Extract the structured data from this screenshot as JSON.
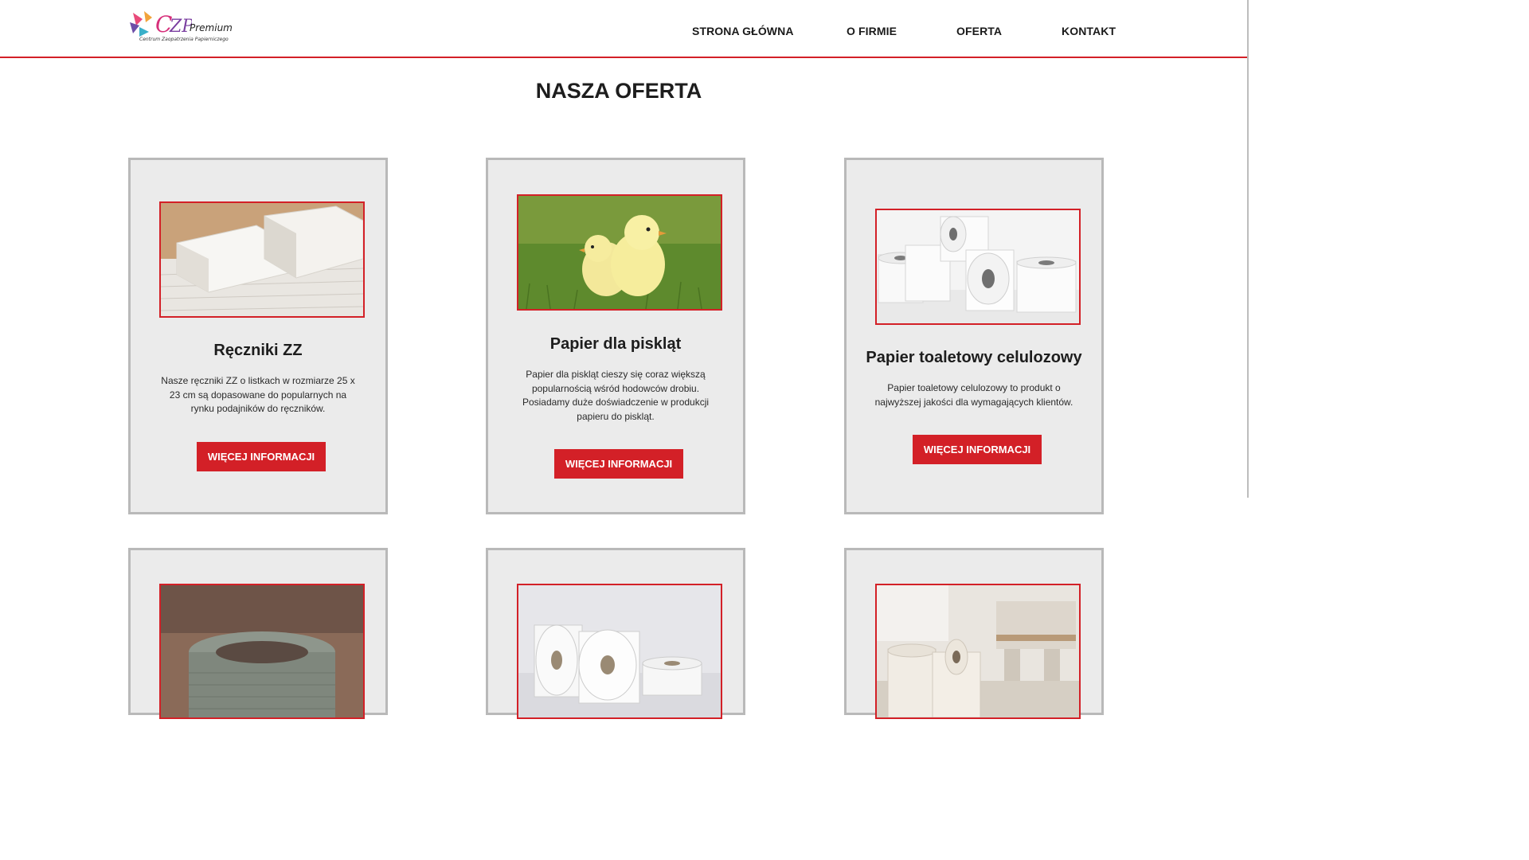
{
  "header": {
    "logo": {
      "brand": "CZP",
      "premium": "Premium",
      "subtitle": "Centrum Zaopatrzenia Papierniczego"
    },
    "nav": [
      "STRONA GŁÓWNA",
      "O FIRMIE",
      "OFERTA",
      "KONTAKT"
    ]
  },
  "main": {
    "title": "NASZA OFERTA",
    "cards": [
      {
        "title": "Ręczniki ZZ",
        "description": "Nasze ręczniki ZZ o listkach w rozmiarze 25 x 23 cm są dopasowane do popularnych na rynku podajników do ręczników.",
        "button": "WIĘCEJ INFORMACJI",
        "image": "folded-paper-towels"
      },
      {
        "title": "Papier dla piskląt",
        "description": "Papier dla piskląt cieszy się coraz większą popularnością wśród hodowców drobiu. Posiadamy duże doświadczenie w produkcji papieru do piskląt.",
        "button": "WIĘCEJ INFORMACJI",
        "image": "chicks-on-grass"
      },
      {
        "title": "Papier toaletowy celulozowy",
        "description": "Papier toaletowy celulozowy to produkt o najwyższej jakości dla wymagających klientów.",
        "button": "WIĘCEJ INFORMACJI",
        "image": "toilet-paper-rolls"
      },
      {
        "image": "grey-paper-roll"
      },
      {
        "image": "jumbo-paper-rolls"
      },
      {
        "image": "kitchen-towel-rolls"
      }
    ]
  },
  "colors": {
    "accent": "#d32027",
    "card_bg": "#ebebeb",
    "card_border": "#b9b9b9"
  }
}
